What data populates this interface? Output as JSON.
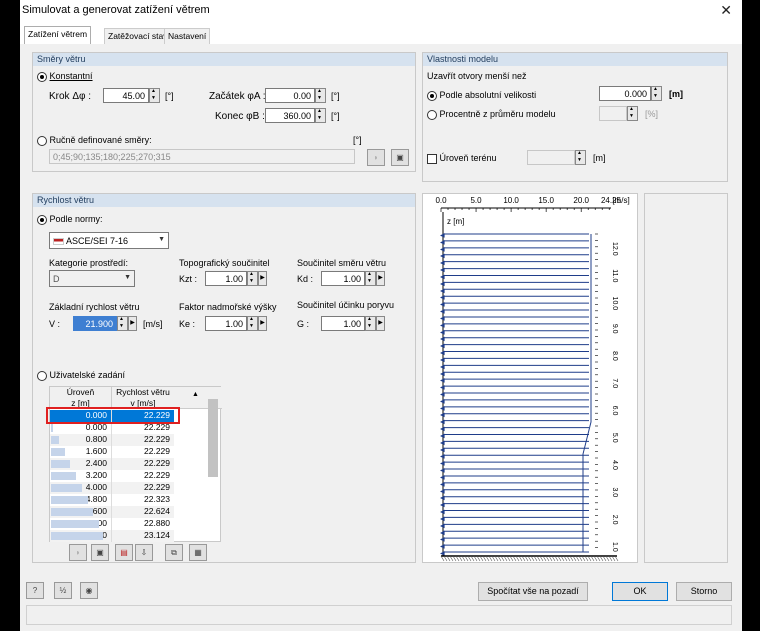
{
  "window": {
    "title": "Simulovat a generovat zatížení větrem",
    "close": "✕"
  },
  "tabs": [
    "Zatížení větrem",
    "Zatěžovací stavy",
    "Nastavení"
  ],
  "directions": {
    "title": "Směry větru",
    "constant": "Konstantní",
    "step_label": "Krok Δφ :",
    "step_value": "45.00",
    "step_unit": "[°]",
    "start_label": "Začátek φA :",
    "start_value": "0.00",
    "start_unit": "[°]",
    "end_label": "Konec φB :",
    "end_value": "360.00",
    "end_unit": "[°]",
    "manual": "Ručně definované směry:",
    "manual_unit": "[°]",
    "manual_value": "0;45;90;135;180;225;270;315"
  },
  "model": {
    "title": "Vlastnosti modelu",
    "close_openings": "Uzavřít otvory menší než",
    "absolute": "Podle absolutní velikosti",
    "abs_value": "0.000",
    "abs_unit": "[m]",
    "percent": "Procentně z průměru modelu",
    "pct_unit": "[%]",
    "terrain": "Úroveň terénu",
    "terrain_unit": "[m]"
  },
  "speed": {
    "title": "Rychlost větru",
    "norm": "Podle normy:",
    "norm_value": "ASCE/SEI 7-16",
    "env_label": "Kategorie prostředí:",
    "env_value": "D",
    "topo_label": "Topografický součinitel",
    "kzt": "Kzt :",
    "kzt_value": "1.00",
    "dir_label": "Součinitel směru větru",
    "kd": "Kd :",
    "kd_value": "1.00",
    "basic_label": "Základní rychlost větru",
    "v": "V :",
    "v_value": "21.900",
    "v_unit": "[m/s]",
    "elev_label": "Faktor nadmořské výšky",
    "ke": "Ke :",
    "ke_value": "1.00",
    "gust_label": "Součinitel účinku poryvu",
    "g": "G :",
    "g_value": "1.00",
    "user": "Uživatelské zadání",
    "col1a": "Úroveň",
    "col1b": "z [m]",
    "col2a": "Rychlost větru",
    "col2b": "v [m/s]",
    "rows": [
      [
        "0.000",
        "22.229"
      ],
      [
        "0.000",
        "22.229"
      ],
      [
        "0.800",
        "22.229"
      ],
      [
        "1.600",
        "22.229"
      ],
      [
        "2.400",
        "22.229"
      ],
      [
        "3.200",
        "22.229"
      ],
      [
        "4.000",
        "22.229"
      ],
      [
        "4.800",
        "22.323"
      ],
      [
        "5.600",
        "22.624"
      ],
      [
        "6.400",
        "22.880"
      ],
      [
        "7.200",
        "23.124"
      ]
    ]
  },
  "chart": {
    "x_ticks": [
      "0.0",
      "5.0",
      "10.0",
      "15.0",
      "20.0",
      "24.25"
    ],
    "x_unit": "[m/s]",
    "z_label": "z [m]",
    "y_ticks": [
      "12.0",
      "11.0",
      "10.0",
      "9.0",
      "8.0",
      "7.0",
      "6.0",
      "5.0",
      "4.0",
      "3.0",
      "2.0",
      "1.0"
    ]
  },
  "footer": {
    "compute": "Spočítat vše na pozadí",
    "ok": "OK",
    "cancel": "Storno"
  },
  "accent": "#0078d7"
}
